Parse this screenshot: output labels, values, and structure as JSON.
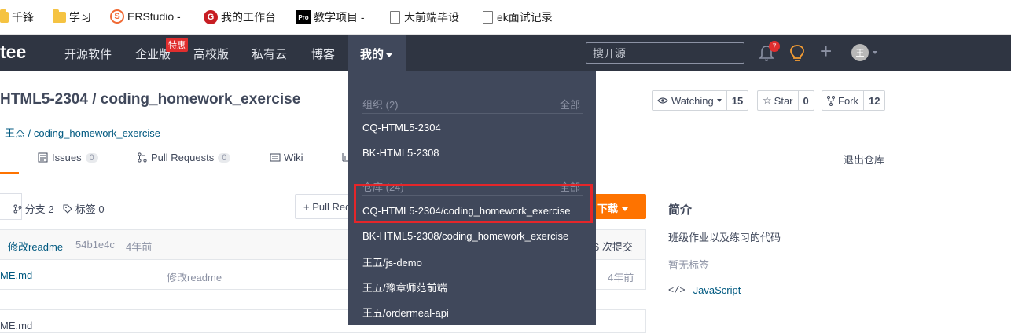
{
  "bookmarks": [
    {
      "label": "千锋",
      "icon": "folder-icon"
    },
    {
      "label": "学习",
      "icon": "folder-icon"
    },
    {
      "label": "ERStudio -",
      "icon": "s-logo-icon"
    },
    {
      "label": "我的工作台",
      "icon": "g-logo-icon"
    },
    {
      "label": "教学项目 -",
      "icon": "pro-logo-icon"
    },
    {
      "label": "大前端毕设",
      "icon": "page-icon"
    },
    {
      "label": "ek面试记录",
      "icon": "page-icon"
    }
  ],
  "icon_text": {
    "s_logo": "S",
    "g_logo": "G",
    "pro_logo": "Pro"
  },
  "navbar": {
    "logo": "tee",
    "items": [
      "开源软件",
      "企业版",
      "高校版",
      "私有云",
      "博客"
    ],
    "badge": "特惠",
    "mine": "我的",
    "search_placeholder": "搜开源",
    "notifications": "7",
    "avatar_initial": "王"
  },
  "repo": {
    "title": "HTML5-2304 / coding_homework_exercise",
    "subpath": "王杰 / coding_homework_exercise",
    "watching": {
      "label": "Watching",
      "count": "15"
    },
    "star": {
      "label": "Star",
      "count": "0"
    },
    "fork": {
      "label": "Fork",
      "count": "12"
    }
  },
  "tabs": {
    "issues": {
      "label": "Issues",
      "count": "0"
    },
    "pull_requests": {
      "label": "Pull Requests",
      "count": "0"
    },
    "wiki": {
      "label": "Wiki"
    },
    "leave": "退出仓库"
  },
  "branches": {
    "info": "分支 2",
    "tags": "标签 0",
    "pr_button": "+ Pull Request",
    "download": "下载"
  },
  "commit": {
    "message": "修改readme",
    "sha": "54b1e4c",
    "time": "4年前",
    "count": "6 次提交"
  },
  "files": [
    {
      "name": "ME.md",
      "message": "修改readme",
      "time": "4年前"
    }
  ],
  "readme_label": "ME.md",
  "sidebar": {
    "title": "简介",
    "description": "班级作业以及练习的代码",
    "tags": "暂无标签",
    "language": "JavaScript",
    "code_glyph": "</>"
  },
  "dropdown": {
    "orgs_header": "组织 (2)",
    "orgs_all": "全部",
    "orgs": [
      "CQ-HTML5-2304",
      "BK-HTML5-2308"
    ],
    "repos_header": "仓库 (24)",
    "repos_all": "全部",
    "repos": [
      "CQ-HTML5-2304/coding_homework_exercise",
      "BK-HTML5-2308/coding_homework_exercise",
      "王五/js-demo",
      "王五/豫章师范前端",
      "王五/ordermeal-api"
    ]
  },
  "colors": {
    "accent": "#fe7300",
    "nav_bg": "#2f3542",
    "dropdown_bg": "#40485b",
    "highlight": "#e4262a",
    "link": "#005980"
  }
}
